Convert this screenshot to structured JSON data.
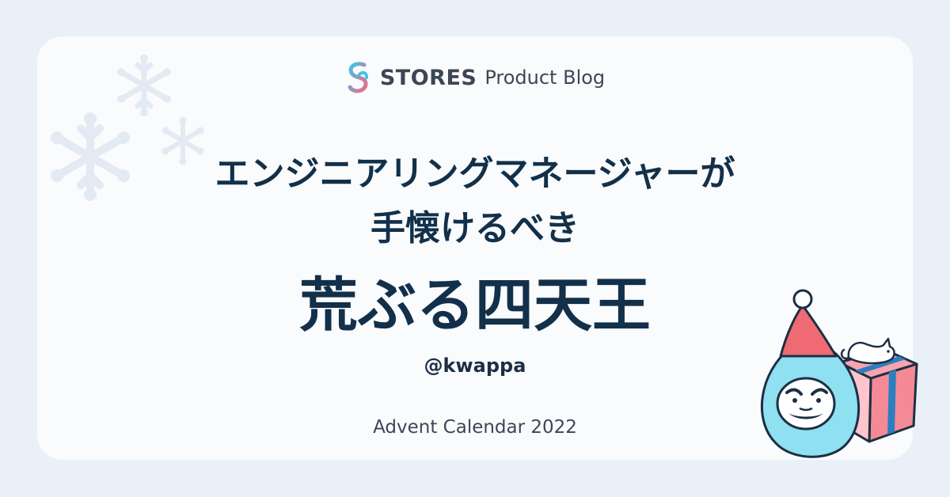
{
  "brand": {
    "name": "STORES",
    "suffix": "Product Blog",
    "logo_icon": "stores-logo-icon"
  },
  "title": {
    "line1": "エンジニアリングマネージャーが",
    "line2": "手懐けるべき",
    "line3": "荒ぶる四天王"
  },
  "author": "@kwappa",
  "event": "Advent Calendar 2022",
  "colors": {
    "background": "#e9f0f8",
    "card": "#fafbfd",
    "title": "#12304a",
    "snowflake": "#e3eaf3",
    "daruma": "#8fe0f0",
    "hat": "#f06a74",
    "gift": "#f48a96",
    "ribbon": "#2c7fbf"
  },
  "decorations": [
    "snowflake-icon",
    "daruma-icon",
    "gift-box-icon",
    "cat-icon",
    "santa-hat-icon"
  ]
}
